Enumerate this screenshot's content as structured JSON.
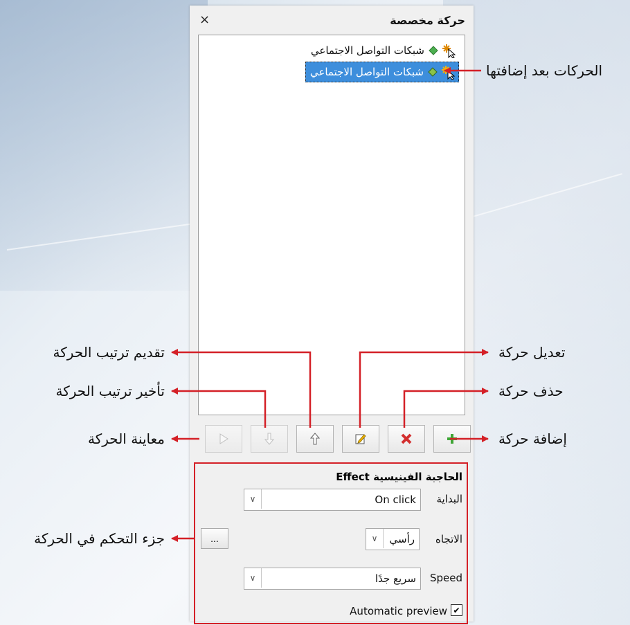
{
  "panel": {
    "title": "حركة مخصصة",
    "close_symbol": "×",
    "items": [
      {
        "label": "شبكات التواصل الاجتماعي",
        "selected": false
      },
      {
        "label": "شبكات التواصل الاجتماعي",
        "selected": true
      }
    ]
  },
  "toolbar": {
    "buttons": [
      {
        "name": "add",
        "icon": "plus-icon",
        "enabled": true
      },
      {
        "name": "delete",
        "icon": "x-icon",
        "enabled": true
      },
      {
        "name": "edit",
        "icon": "edit-icon",
        "enabled": true
      },
      {
        "name": "move-up",
        "icon": "arrow-up-icon",
        "enabled": true
      },
      {
        "name": "move-down",
        "icon": "arrow-down-icon",
        "enabled": false
      },
      {
        "name": "preview",
        "icon": "play-icon",
        "enabled": false
      }
    ]
  },
  "controls": {
    "effect_label": "Effect",
    "effect_name": "الحاجبة الفينيسية",
    "start_label": "البداية",
    "start_value": "On click",
    "direction_label": "الاتجاه",
    "direction_value": "رأسي",
    "speed_label": "Speed",
    "speed_value": "سريع جدًا",
    "options_button": "...",
    "auto_preview_label": "Automatic preview",
    "auto_preview_checked": true
  },
  "annotations": {
    "added": "الحركات بعد إضافتها",
    "edit": "تعديل حركة",
    "delete": "حذف حركة",
    "add": "إضافة حركة",
    "move_up": "تقديم ترتيب الحركة",
    "move_down": "تأخير ترتيب الحركة",
    "preview": "معاينة الحركة",
    "controls": "جزء التحكم في الحركة"
  },
  "colors": {
    "annotation_arrow": "#d42027",
    "selection": "#3d8edc",
    "frame": "#d42027"
  }
}
